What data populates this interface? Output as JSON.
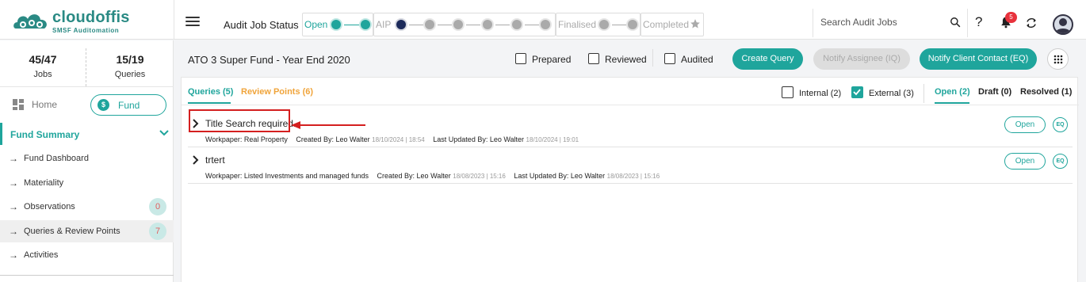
{
  "brand": {
    "name": "cloudoffis",
    "tagline": "SMSF Auditomation",
    "color": "#2a8a84"
  },
  "accent": "#1fa59c",
  "header": {
    "status_label": "Audit Job Status",
    "stages": [
      {
        "name": "Open",
        "state": "current"
      },
      {
        "name": "AIP",
        "state": "pending"
      },
      {
        "name": "Finalised",
        "state": "pending"
      },
      {
        "name": "Completed",
        "state": "pending"
      }
    ],
    "search_placeholder": "Search Audit Jobs",
    "help": "?",
    "notification_count": "5",
    "icons": [
      "menu-icon",
      "search-icon",
      "help-icon",
      "bell-icon",
      "sync-icon",
      "user-avatar"
    ]
  },
  "sidebar": {
    "jobs_count": "45/47",
    "jobs_label": "Jobs",
    "queries_count": "15/19",
    "queries_label": "Queries",
    "home_label": "Home",
    "fund_label": "Fund",
    "section_title": "Fund Summary",
    "items": [
      {
        "label": "Fund Dashboard"
      },
      {
        "label": "Materiality"
      },
      {
        "label": "Observations",
        "badge": "0"
      },
      {
        "label": "Queries & Review Points",
        "badge": "7",
        "active": true
      },
      {
        "label": "Activities"
      }
    ]
  },
  "fund": {
    "title": "ATO 3 Super Fund - Year End 2020",
    "checks": [
      {
        "label": "Prepared",
        "checked": false
      },
      {
        "label": "Reviewed",
        "checked": false
      },
      {
        "label": "Audited",
        "checked": false
      }
    ],
    "buttons": {
      "create_query": "Create Query",
      "notify_assignee": "Notify Assignee (IQ)",
      "notify_client": "Notify Client Contact (EQ)"
    }
  },
  "tabs": {
    "queries": "Queries (5)",
    "review_points": "Review Points (6)"
  },
  "filters": {
    "internal": {
      "label": "Internal (2)",
      "checked": false
    },
    "external": {
      "label": "External (3)",
      "checked": true
    }
  },
  "status_tabs": {
    "open": "Open (2)",
    "draft": "Draft (0)",
    "resolved": "Resolved (1)"
  },
  "queries": [
    {
      "title": "Title Search required.",
      "workpaper_label": "Workpaper:",
      "workpaper": "Real Property",
      "created_by_label": "Created By:",
      "created_by": "Leo Walter",
      "created_at": "18/10/2024 | 18:54",
      "updated_label": "Last Updated By:",
      "updated_by": "Leo Walter",
      "updated_at": "18/10/2024 | 19:01",
      "status": "Open",
      "type": "EQ"
    },
    {
      "title": "trtert",
      "workpaper_label": "Workpaper:",
      "workpaper": "Listed Investments and managed funds",
      "created_by_label": "Created By:",
      "created_by": "Leo Walter",
      "created_at": "18/08/2023 | 15:16",
      "updated_label": "Last Updated By:",
      "updated_by": "Leo Walter",
      "updated_at": "18/08/2023 | 15:16",
      "status": "Open",
      "type": "EQ"
    }
  ],
  "annotation_color": "#d41f1f"
}
